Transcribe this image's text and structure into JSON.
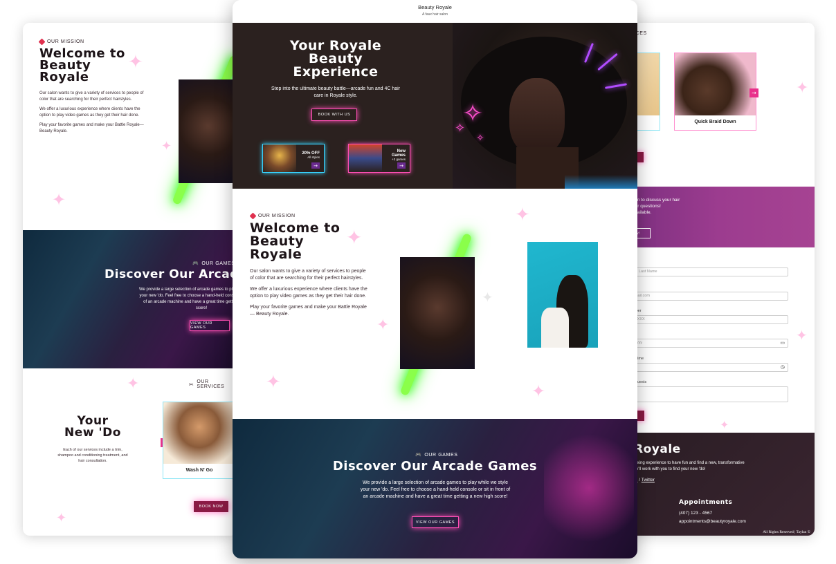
{
  "colors": {
    "accent_pink": "#ff4fb5",
    "neon_green": "#3dff20",
    "neon_purple": "#b14cff",
    "dark_bg": "#2b211f",
    "burgundy": "#8b1a45"
  },
  "left_panel": {
    "mission": {
      "tag": "OUR MISSION",
      "title_line1": "Welcome to",
      "title_line2": "Beauty",
      "title_line3": "Royale",
      "p1": "Our salon wants to give a variety of services to people of color that are searching for their perfect hairstyles.",
      "p2": "We offer a luxurious experience where clients have the option to play video games as they get their hair done.",
      "p3": "Play your favorite games and make your Battle Royale— Beauty Royale."
    },
    "games": {
      "tag": "OUR GAMES",
      "title": "Discover Our Arcade Games",
      "desc": "We provide a large selection of arcade games to play while we style your new 'do. Feel free to choose a hand-held console or sit in front of an arcade machine and have a great time getting a new high score!",
      "button": "VIEW OUR GAMES"
    },
    "services": {
      "tag": "OUR SERVICES",
      "title_line1": "Your",
      "title_line2": "New 'Do",
      "desc": "Each of our services include a trim, shampoo and conditioning treatment, and hair consultation.",
      "card_label": "Wash N' Go",
      "button": "BOOK NOW"
    }
  },
  "center_panel": {
    "brand": "Beauty Royale",
    "tagline": "A faux hair salon",
    "hero": {
      "title_line1": "Your Royale",
      "title_line2": "Beauty",
      "title_line3": "Experience",
      "subtitle": "Step into the ultimate beauty battle—arcade fun and 4C hair care in Royale style.",
      "button": "BOOK WITH US",
      "promo1_title": "20% OFF",
      "promo1_sub": "All styles",
      "promo2_title": "New Games",
      "promo2_sub": "+2 games"
    },
    "mission": {
      "tag": "OUR MISSION",
      "title_line1": "Welcome to",
      "title_line2": "Beauty",
      "title_line3": "Royale",
      "p1": "Our salon wants to give a variety of services to people of color that are searching for their perfect hairstyles.",
      "p2": "We offer a luxurious experience where clients have the option to play video games as they get their hair done.",
      "p3": "Play your favorite games and make your Battle Royale— Beauty Royale."
    },
    "games": {
      "tag": "OUR GAMES",
      "title": "Discover Our Arcade Games",
      "desc": "We provide a large selection of arcade games to play while we style your new 'do. Feel free to choose a hand-held console or sit in front of an arcade machine and have a great time getting a new high score!",
      "button": "VIEW OUR GAMES"
    }
  },
  "right_panel": {
    "services_tag": "ICES",
    "card_label": "Quick Braid Down",
    "contact_line1": "tion to discuss your hair",
    "contact_line2": "our questions!",
    "contact_line3": "available.",
    "contact_button": "ow!",
    "form": {
      "last_name_placeholder": "Last Name",
      "email_placeholder": "mail.com",
      "phone_label": "mber",
      "phone_placeholder": "XXXX",
      "date_label": "e",
      "date_placeholder": "yyyy",
      "time_label": "Time",
      "requests_label": "quests"
    },
    "footer": {
      "brand": "Royale",
      "desc_line1": "laxing experience to have fun and find a new, transformative",
      "desc_line2": "ve'll work with you to find your new 'do!",
      "social_1": "m",
      "social_sep": "/",
      "social_2": "Twitter",
      "appointments_title": "Appointments",
      "phone": "(407) 123 - 4567",
      "email": "appointments@beautyroyale.com",
      "copyright": "All Rights Reserved | Taylan ©"
    }
  },
  "icons": [
    "heart-icon",
    "gamepad-icon",
    "scissors-icon",
    "arrow-right-icon",
    "arrow-left-icon",
    "sparkle-icon",
    "calendar-icon",
    "clock-icon"
  ]
}
